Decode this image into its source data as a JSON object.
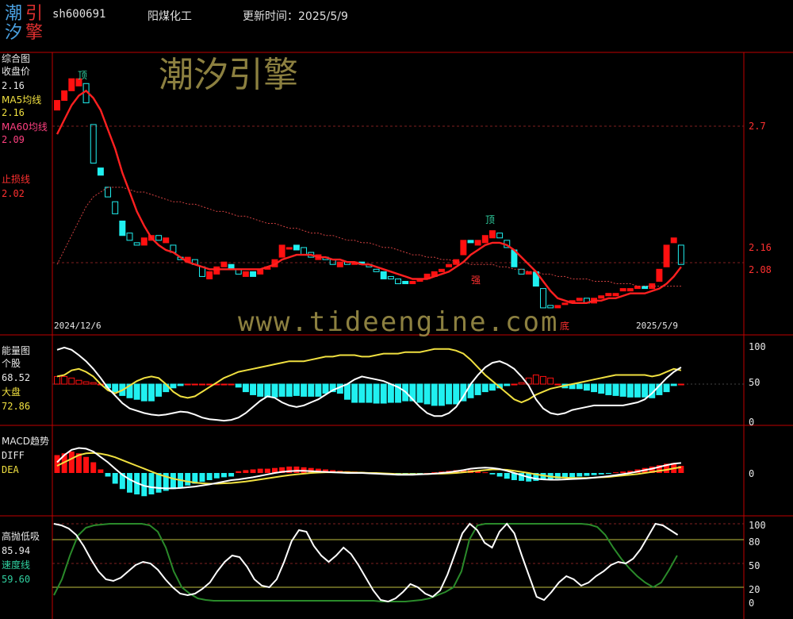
{
  "header": {
    "logo_chars": [
      "潮",
      "引",
      "汐",
      "擎"
    ],
    "code": "sh600691",
    "name": "阳煤化工",
    "update": "更新时间：2025/5/9"
  },
  "watermarks": {
    "cn": "潮汐引擎",
    "url": "www.tideengine.com"
  },
  "colors": {
    "up": "#ff1010",
    "down": "#20f0f0",
    "ma5": "#ff2020",
    "ma60": "#d04040",
    "axis": "#c00000"
  },
  "chart_data": [
    {
      "type": "candlestick",
      "title": "综合图",
      "legend": [
        {
          "name": "收盘价",
          "value": "2.16"
        },
        {
          "name": "MA5均线",
          "value": "2.16"
        },
        {
          "name": "MA60均线",
          "value": "2.09"
        },
        {
          "name": "止损线",
          "value": "2.02"
        }
      ],
      "y_ticks": [
        "2.7",
        "2.16",
        "2.08"
      ],
      "x_labels": [
        "2024/12/6",
        "2025/5/9"
      ],
      "annotations": [
        "顶",
        "顶",
        "强",
        "底"
      ],
      "closes": [
        2.86,
        2.9,
        2.95,
        2.95,
        2.85,
        2.6,
        2.55,
        2.46,
        2.39,
        2.3,
        2.28,
        2.26,
        2.29,
        2.3,
        2.28,
        2.29,
        2.23,
        2.2,
        2.21,
        2.18,
        2.13,
        2.15,
        2.17,
        2.19,
        2.16,
        2.14,
        2.15,
        2.13,
        2.16,
        2.17,
        2.2,
        2.26,
        2.25,
        2.24,
        2.22,
        2.21,
        2.22,
        2.2,
        2.18,
        2.19,
        2.18,
        2.19,
        2.18,
        2.17,
        2.15,
        2.12,
        2.12,
        2.1,
        2.1,
        2.11,
        2.12,
        2.14,
        2.15,
        2.16,
        2.18,
        2.2,
        2.28,
        2.27,
        2.28,
        2.3,
        2.32,
        2.29,
        2.25,
        2.17,
        2.14,
        2.15,
        2.09,
        2.0,
        2.0,
        2.01,
        2.02,
        2.03,
        2.04,
        2.02,
        2.04,
        2.05,
        2.06,
        2.06,
        2.08,
        2.08,
        2.09,
        2.08,
        2.1,
        2.16,
        2.26,
        2.29,
        2.18
      ],
      "opens": [
        2.82,
        2.86,
        2.9,
        2.92,
        2.93,
        2.76,
        2.58,
        2.5,
        2.44,
        2.36,
        2.31,
        2.27,
        2.26,
        2.28,
        2.3,
        2.27,
        2.26,
        2.21,
        2.19,
        2.2,
        2.17,
        2.12,
        2.14,
        2.17,
        2.18,
        2.16,
        2.13,
        2.15,
        2.14,
        2.16,
        2.17,
        2.21,
        2.25,
        2.26,
        2.25,
        2.23,
        2.2,
        2.21,
        2.2,
        2.17,
        2.19,
        2.18,
        2.19,
        2.18,
        2.16,
        2.15,
        2.13,
        2.12,
        2.11,
        2.1,
        2.11,
        2.12,
        2.13,
        2.15,
        2.17,
        2.18,
        2.22,
        2.28,
        2.26,
        2.27,
        2.29,
        2.31,
        2.28,
        2.24,
        2.16,
        2.14,
        2.15,
        2.08,
        2.01,
        2.0,
        2.02,
        2.02,
        2.03,
        2.04,
        2.02,
        2.04,
        2.05,
        2.05,
        2.07,
        2.07,
        2.08,
        2.09,
        2.08,
        2.11,
        2.17,
        2.27,
        2.26
      ],
      "ma5": [
        2.72,
        2.78,
        2.84,
        2.88,
        2.9,
        2.87,
        2.82,
        2.74,
        2.66,
        2.56,
        2.48,
        2.4,
        2.34,
        2.29,
        2.26,
        2.24,
        2.23,
        2.21,
        2.19,
        2.18,
        2.17,
        2.16,
        2.16,
        2.16,
        2.16,
        2.16,
        2.16,
        2.16,
        2.16,
        2.17,
        2.18,
        2.2,
        2.21,
        2.22,
        2.22,
        2.22,
        2.21,
        2.21,
        2.2,
        2.2,
        2.19,
        2.19,
        2.18,
        2.18,
        2.17,
        2.16,
        2.15,
        2.14,
        2.13,
        2.12,
        2.12,
        2.12,
        2.13,
        2.14,
        2.15,
        2.17,
        2.19,
        2.22,
        2.24,
        2.26,
        2.27,
        2.27,
        2.26,
        2.24,
        2.21,
        2.18,
        2.15,
        2.11,
        2.07,
        2.04,
        2.03,
        2.02,
        2.02,
        2.02,
        2.03,
        2.03,
        2.04,
        2.04,
        2.05,
        2.06,
        2.06,
        2.06,
        2.07,
        2.08,
        2.1,
        2.13,
        2.17
      ],
      "ma60": [
        2.18,
        2.24,
        2.3,
        2.36,
        2.42,
        2.46,
        2.48,
        2.5,
        2.5,
        2.5,
        2.49,
        2.48,
        2.48,
        2.47,
        2.46,
        2.45,
        2.44,
        2.44,
        2.43,
        2.43,
        2.42,
        2.41,
        2.4,
        2.4,
        2.39,
        2.38,
        2.38,
        2.37,
        2.36,
        2.35,
        2.35,
        2.34,
        2.33,
        2.33,
        2.32,
        2.31,
        2.31,
        2.3,
        2.3,
        2.29,
        2.28,
        2.28,
        2.27,
        2.27,
        2.26,
        2.25,
        2.25,
        2.24,
        2.23,
        2.22,
        2.22,
        2.21,
        2.21,
        2.2,
        2.2,
        2.19,
        2.19,
        2.18,
        2.18,
        2.18,
        2.18,
        2.17,
        2.17,
        2.16,
        2.16,
        2.15,
        2.15,
        2.14,
        2.14,
        2.13,
        2.13,
        2.12,
        2.12,
        2.12,
        2.11,
        2.11,
        2.11,
        2.1,
        2.1,
        2.1,
        2.09,
        2.09,
        2.09,
        2.09,
        2.09,
        2.09,
        2.09
      ],
      "ylim": [
        1.98,
        3.0
      ]
    },
    {
      "type": "bar+line",
      "title": "能量图",
      "legend": [
        {
          "name": "个股",
          "value": "68.52"
        },
        {
          "name": "大盘",
          "value": "72.86"
        }
      ],
      "y_ticks": [
        "100",
        "50",
        "0"
      ],
      "ylim": [
        0,
        100
      ],
      "bars": [
        60,
        60,
        58,
        55,
        53,
        52,
        50,
        45,
        40,
        35,
        32,
        30,
        28,
        28,
        34,
        40,
        45,
        48,
        50,
        50,
        50,
        50,
        50,
        50,
        50,
        46,
        40,
        36,
        34,
        33,
        33,
        34,
        34,
        35,
        34,
        34,
        34,
        38,
        40,
        38,
        30,
        26,
        26,
        26,
        25,
        25,
        26,
        26,
        28,
        28,
        26,
        24,
        22,
        22,
        24,
        24,
        28,
        32,
        36,
        40,
        42,
        45,
        48,
        50,
        52,
        58,
        62,
        60,
        58,
        50,
        45,
        44,
        44,
        42,
        40,
        38,
        36,
        35,
        34,
        33,
        33,
        33,
        32,
        36,
        40,
        48,
        50
      ],
      "stock_line": [
        95,
        98,
        95,
        88,
        80,
        70,
        58,
        45,
        35,
        25,
        18,
        15,
        12,
        10,
        9,
        10,
        12,
        14,
        13,
        10,
        6,
        4,
        3,
        2,
        3,
        6,
        12,
        20,
        28,
        34,
        32,
        26,
        22,
        20,
        22,
        26,
        30,
        36,
        42,
        46,
        50,
        56,
        60,
        58,
        56,
        54,
        50,
        46,
        40,
        30,
        20,
        12,
        8,
        8,
        12,
        20,
        34,
        50,
        62,
        72,
        78,
        80,
        76,
        70,
        60,
        48,
        30,
        18,
        12,
        10,
        12,
        16,
        18,
        20,
        22,
        22,
        22,
        22,
        22,
        24,
        26,
        30,
        38,
        48,
        58,
        66,
        72
      ],
      "market_line": [
        60,
        62,
        68,
        70,
        66,
        60,
        50,
        42,
        38,
        42,
        48,
        54,
        58,
        60,
        58,
        50,
        40,
        34,
        32,
        34,
        40,
        46,
        52,
        58,
        62,
        66,
        68,
        70,
        72,
        74,
        76,
        78,
        80,
        80,
        80,
        82,
        84,
        86,
        86,
        88,
        88,
        88,
        86,
        86,
        88,
        90,
        90,
        90,
        92,
        92,
        92,
        94,
        96,
        96,
        96,
        94,
        90,
        82,
        72,
        62,
        54,
        46,
        38,
        30,
        26,
        30,
        36,
        40,
        44,
        46,
        48,
        50,
        52,
        54,
        56,
        58,
        60,
        62,
        62,
        62,
        62,
        62,
        60,
        62,
        66,
        70,
        68
      ]
    },
    {
      "type": "bar+line",
      "title": "MACD趋势",
      "legend": [
        {
          "name": "DIFF",
          "value": ""
        },
        {
          "name": "DEA",
          "value": ""
        }
      ],
      "y_ticks": [
        "0"
      ],
      "ylim": [
        -0.12,
        0.12
      ],
      "hist": [
        0.05,
        0.055,
        0.06,
        0.055,
        0.045,
        0.03,
        0.01,
        -0.01,
        -0.03,
        -0.045,
        -0.055,
        -0.06,
        -0.065,
        -0.06,
        -0.055,
        -0.05,
        -0.045,
        -0.04,
        -0.035,
        -0.03,
        -0.025,
        -0.02,
        -0.015,
        -0.012,
        -0.01,
        0.005,
        0.008,
        0.01,
        0.012,
        0.012,
        0.014,
        0.016,
        0.018,
        0.018,
        0.016,
        0.014,
        0.012,
        0.01,
        0.008,
        0.006,
        0.005,
        0.004,
        0.003,
        0.002,
        0.0,
        -0.002,
        -0.004,
        -0.004,
        -0.003,
        -0.002,
        -0.001,
        0.0,
        0.002,
        0.004,
        0.006,
        0.008,
        0.009,
        0.008,
        0.006,
        0.002,
        -0.004,
        -0.01,
        -0.016,
        -0.02,
        -0.022,
        -0.024,
        -0.022,
        -0.02,
        -0.018,
        -0.016,
        -0.014,
        -0.012,
        -0.01,
        -0.008,
        -0.006,
        -0.004,
        -0.002,
        0.002,
        0.004,
        0.006,
        0.01,
        0.014,
        0.018,
        0.022,
        0.026,
        0.028,
        0.02
      ],
      "diff": [
        0.03,
        0.05,
        0.065,
        0.07,
        0.068,
        0.06,
        0.045,
        0.03,
        0.012,
        -0.005,
        -0.018,
        -0.028,
        -0.036,
        -0.04,
        -0.042,
        -0.043,
        -0.043,
        -0.042,
        -0.04,
        -0.038,
        -0.035,
        -0.032,
        -0.028,
        -0.024,
        -0.02,
        -0.018,
        -0.015,
        -0.012,
        -0.008,
        -0.004,
        0.0,
        0.003,
        0.005,
        0.006,
        0.006,
        0.005,
        0.004,
        0.003,
        0.002,
        0.001,
        0.0,
        0.0,
        0.0,
        -0.001,
        -0.002,
        -0.003,
        -0.004,
        -0.005,
        -0.005,
        -0.005,
        -0.004,
        -0.003,
        -0.002,
        0.0,
        0.002,
        0.005,
        0.008,
        0.012,
        0.014,
        0.015,
        0.014,
        0.011,
        0.006,
        0.0,
        -0.006,
        -0.012,
        -0.016,
        -0.018,
        -0.019,
        -0.019,
        -0.018,
        -0.017,
        -0.016,
        -0.015,
        -0.013,
        -0.011,
        -0.009,
        -0.006,
        -0.003,
        0.0,
        0.004,
        0.008,
        0.012,
        0.017,
        0.022,
        0.026,
        0.028
      ],
      "dea": [
        0.02,
        0.03,
        0.04,
        0.05,
        0.055,
        0.056,
        0.054,
        0.05,
        0.044,
        0.036,
        0.028,
        0.02,
        0.012,
        0.004,
        -0.004,
        -0.01,
        -0.016,
        -0.02,
        -0.024,
        -0.027,
        -0.029,
        -0.03,
        -0.03,
        -0.029,
        -0.028,
        -0.026,
        -0.024,
        -0.021,
        -0.018,
        -0.015,
        -0.012,
        -0.009,
        -0.006,
        -0.004,
        -0.002,
        0.0,
        0.001,
        0.002,
        0.002,
        0.002,
        0.002,
        0.001,
        0.001,
        0.0,
        0.0,
        -0.001,
        -0.002,
        -0.003,
        -0.003,
        -0.003,
        -0.003,
        -0.003,
        -0.002,
        -0.002,
        -0.001,
        0.0,
        0.002,
        0.004,
        0.006,
        0.008,
        0.01,
        0.01,
        0.009,
        0.006,
        0.003,
        0.0,
        -0.004,
        -0.007,
        -0.01,
        -0.012,
        -0.013,
        -0.014,
        -0.014,
        -0.014,
        -0.013,
        -0.012,
        -0.011,
        -0.009,
        -0.007,
        -0.005,
        -0.003,
        0.0,
        0.003,
        0.006,
        0.009,
        0.013,
        0.016
      ]
    },
    {
      "type": "line",
      "title": "高抛低吸",
      "legend": [
        {
          "name": "高抛低吸",
          "value": "85.94"
        },
        {
          "name": "速度线",
          "value": "59.60"
        }
      ],
      "y_ticks": [
        "100",
        "80",
        "50",
        "20",
        "0"
      ],
      "ylim": [
        0,
        100
      ],
      "white": [
        100,
        98,
        94,
        86,
        72,
        55,
        40,
        30,
        28,
        32,
        40,
        48,
        52,
        50,
        42,
        30,
        20,
        12,
        10,
        12,
        18,
        26,
        40,
        52,
        60,
        58,
        46,
        30,
        22,
        20,
        30,
        52,
        78,
        92,
        90,
        72,
        60,
        52,
        60,
        70,
        62,
        48,
        32,
        16,
        4,
        2,
        6,
        14,
        24,
        20,
        12,
        8,
        16,
        36,
        62,
        88,
        100,
        92,
        76,
        70,
        90,
        100,
        88,
        60,
        34,
        8,
        4,
        14,
        26,
        34,
        30,
        22,
        26,
        34,
        40,
        48,
        52,
        50,
        56,
        68,
        84,
        100,
        98,
        92,
        86
      ],
      "green": [
        10,
        30,
        60,
        85,
        95,
        98,
        99,
        100,
        100,
        100,
        100,
        100,
        98,
        90,
        70,
        40,
        20,
        12,
        6,
        4,
        3,
        3,
        3,
        3,
        3,
        3,
        3,
        3,
        3,
        3,
        3,
        3,
        3,
        3,
        3,
        3,
        3,
        3,
        3,
        3,
        3,
        2,
        2,
        2,
        2,
        3,
        4,
        6,
        10,
        14,
        20,
        40,
        80,
        98,
        100,
        100,
        100,
        100,
        100,
        100,
        100,
        100,
        100,
        100,
        100,
        100,
        100,
        99,
        96,
        86,
        70,
        56,
        44,
        34,
        26,
        20,
        26,
        42,
        60
      ]
    }
  ]
}
